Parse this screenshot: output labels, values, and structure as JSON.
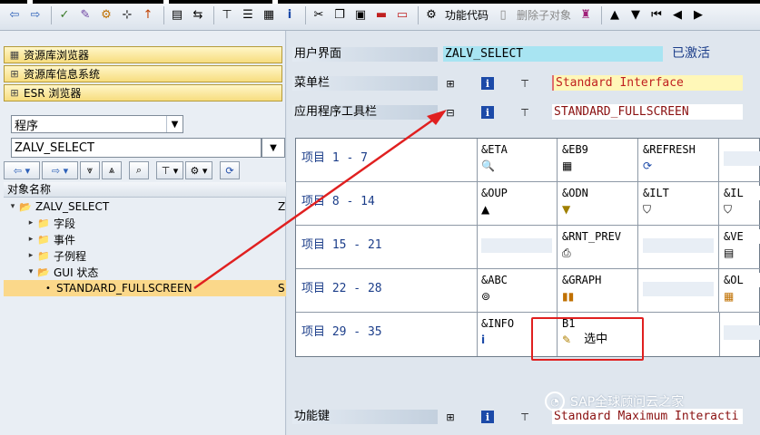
{
  "toolbar": {
    "function_code_label": "功能代码",
    "delete_child_label": "删除子对象"
  },
  "left": {
    "nav_buttons": [
      "资源库浏览器",
      "资源库信息系统",
      "ESR 浏览器"
    ],
    "object_type": "程序",
    "object_name": "ZALV_SELECT",
    "tree_header": "对象名称",
    "tree": [
      {
        "label": "ZALV_SELECT",
        "col2": "Z"
      },
      {
        "label": "字段"
      },
      {
        "label": "事件"
      },
      {
        "label": "子例程"
      },
      {
        "label": "GUI 状态"
      },
      {
        "label": "STANDARD_FULLSCREEN",
        "col2": "S"
      }
    ]
  },
  "right": {
    "user_interface_label": "用户界面",
    "user_interface_value": "ZALV_SELECT",
    "status": "已激活",
    "menu_bar_label": "菜单栏",
    "menu_bar_value": "Standard Interface",
    "app_toolbar_label": "应用程序工具栏",
    "app_toolbar_value": "STANDARD_FULLSCREEN",
    "function_keys_label": "功能键",
    "function_keys_value": "Standard Maximum Interacti",
    "grid_rows": [
      {
        "label": "项目  1 - 7",
        "cells": [
          "&ETA",
          "&EB9",
          "&REFRESH"
        ]
      },
      {
        "label": "项目  8 - 14",
        "cells": [
          "&OUP",
          "&ODN",
          "&ILT",
          "&IL"
        ]
      },
      {
        "label": "项目 15 - 21",
        "cells": [
          "",
          "&RNT_PREV",
          "",
          "&VE"
        ]
      },
      {
        "label": "项目 22 - 28",
        "cells": [
          "&ABC",
          "&GRAPH",
          "",
          "&OL"
        ]
      },
      {
        "label": "项目 29 - 35",
        "cells": [
          "&INFO",
          "B1"
        ]
      }
    ],
    "selected_text": "选中"
  },
  "watermark": "SAP全球顾问云之家",
  "colors": {
    "accent_red": "#e02020",
    "highlight": "#fbd88a"
  }
}
